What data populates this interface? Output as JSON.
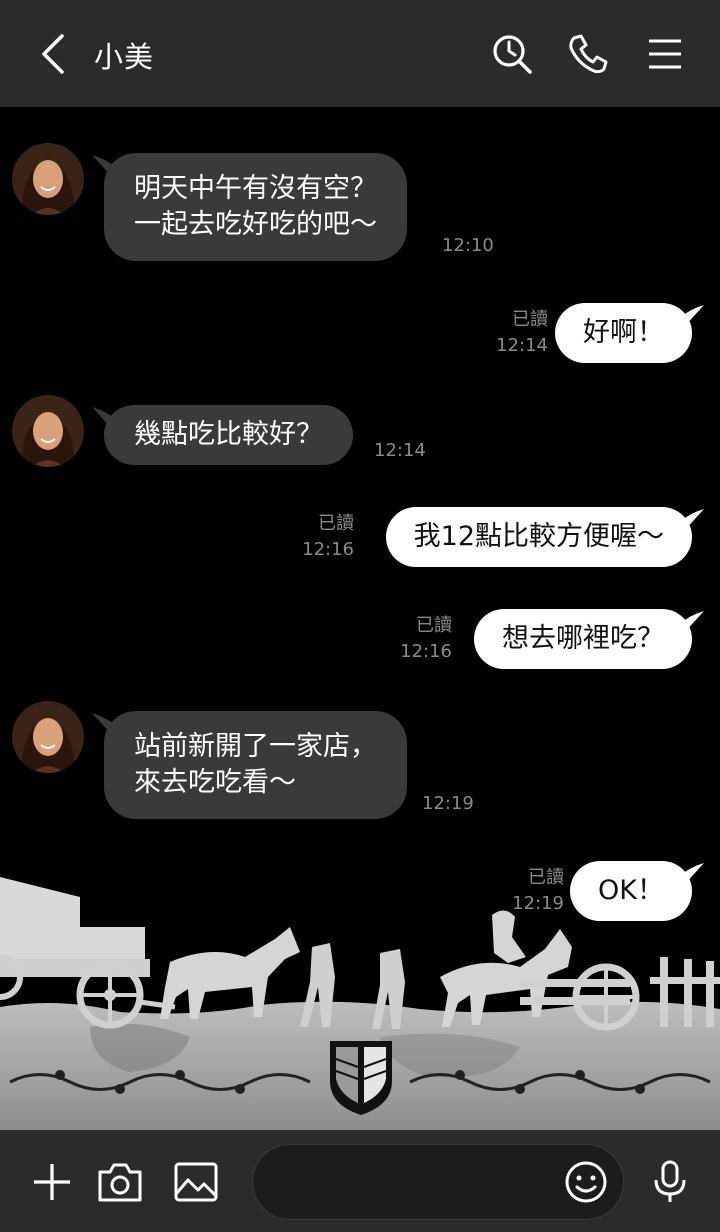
{
  "header": {
    "title": "小美",
    "icons": [
      "back-chevron-icon",
      "search-history-icon",
      "phone-icon",
      "menu-icon"
    ]
  },
  "messages": [
    {
      "side": "in",
      "text": "明天中午有沒有空？\n一起去吃好吃的吧～",
      "time": "12:10"
    },
    {
      "side": "out",
      "text": "好啊！",
      "read": "已讀",
      "time": "12:14"
    },
    {
      "side": "in",
      "text": "幾點吃比較好？",
      "time": "12:14"
    },
    {
      "side": "out",
      "text": "我12點比較方便喔～",
      "read": "已讀",
      "time": "12:16"
    },
    {
      "side": "out",
      "text": "想去哪裡吃？",
      "read": "已讀",
      "time": "12:16"
    },
    {
      "side": "in",
      "text": "站前新開了一家店，\n來去吃吃看～",
      "time": "12:19"
    },
    {
      "side": "out",
      "text": "OK！",
      "read": "已讀",
      "time": "12:19"
    }
  ],
  "bottom": {
    "input_placeholder": "",
    "icons": [
      "plus-icon",
      "camera-icon",
      "image-icon",
      "emoji-icon",
      "microphone-icon"
    ]
  },
  "colors": {
    "header_bg": "#2b2b2b",
    "chat_bg": "#000000",
    "bubble_in": "#3a3a3a",
    "bubble_out": "#ffffff",
    "meta_text": "#8a8a8a"
  }
}
